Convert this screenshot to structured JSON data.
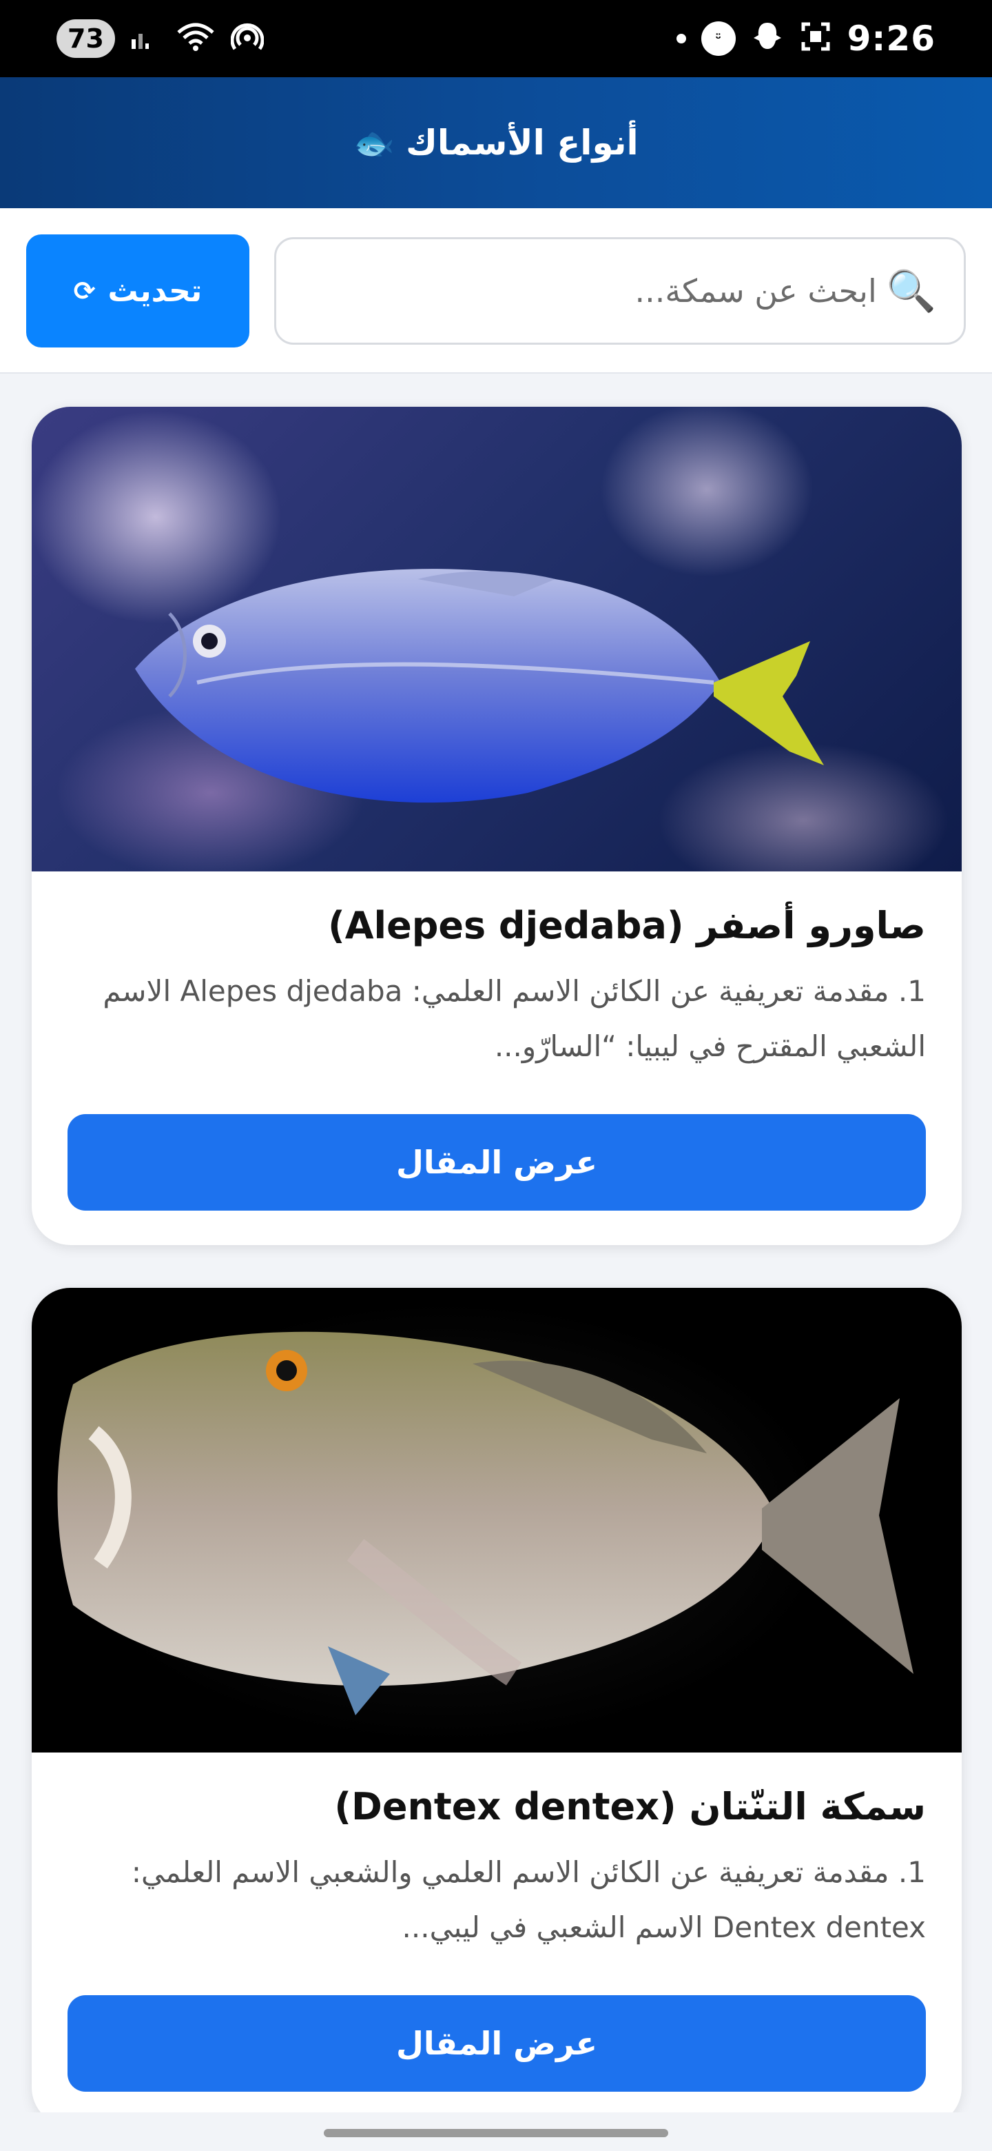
{
  "status_bar": {
    "battery": "73",
    "time": "9:26",
    "icons": [
      "signal-icon",
      "wifi-icon",
      "hotspot-icon",
      "notification-dot",
      "app-badge-icon",
      "snapchat-icon",
      "screenshot-icon"
    ]
  },
  "header": {
    "title": "أنواع الأسماك",
    "icon": "🐟"
  },
  "toolbar": {
    "refresh_label": "تحديث",
    "refresh_icon": "⟳",
    "search_icon": "🔍",
    "search_placeholder": "ابحث عن سمكة..."
  },
  "cards": [
    {
      "title": "صاورو أصفر (Alepes djedaba)",
      "excerpt": "1. مقدمة تعريفية عن الكائن الاسم العلمي: Alepes djedaba الاسم الشعبي المقترح في ليبيا: “السارّو...",
      "button_label": "عرض المقال",
      "image": "blue-yellowtail-fish-photo"
    },
    {
      "title": "سمكة التنّتان (Dentex dentex)",
      "excerpt": "1. مقدمة تعريفية عن الكائن الاسم العلمي والشعبي الاسم العلمي: Dentex dentex الاسم الشعبي في ليبي...",
      "button_label": "عرض المقال",
      "image": "dentex-fish-photo"
    }
  ],
  "colors": {
    "header_gradient_start": "#0a3a78",
    "header_gradient_end": "#0a5aae",
    "refresh_button": "#0a84ff",
    "card_button": "#1d72ee"
  }
}
